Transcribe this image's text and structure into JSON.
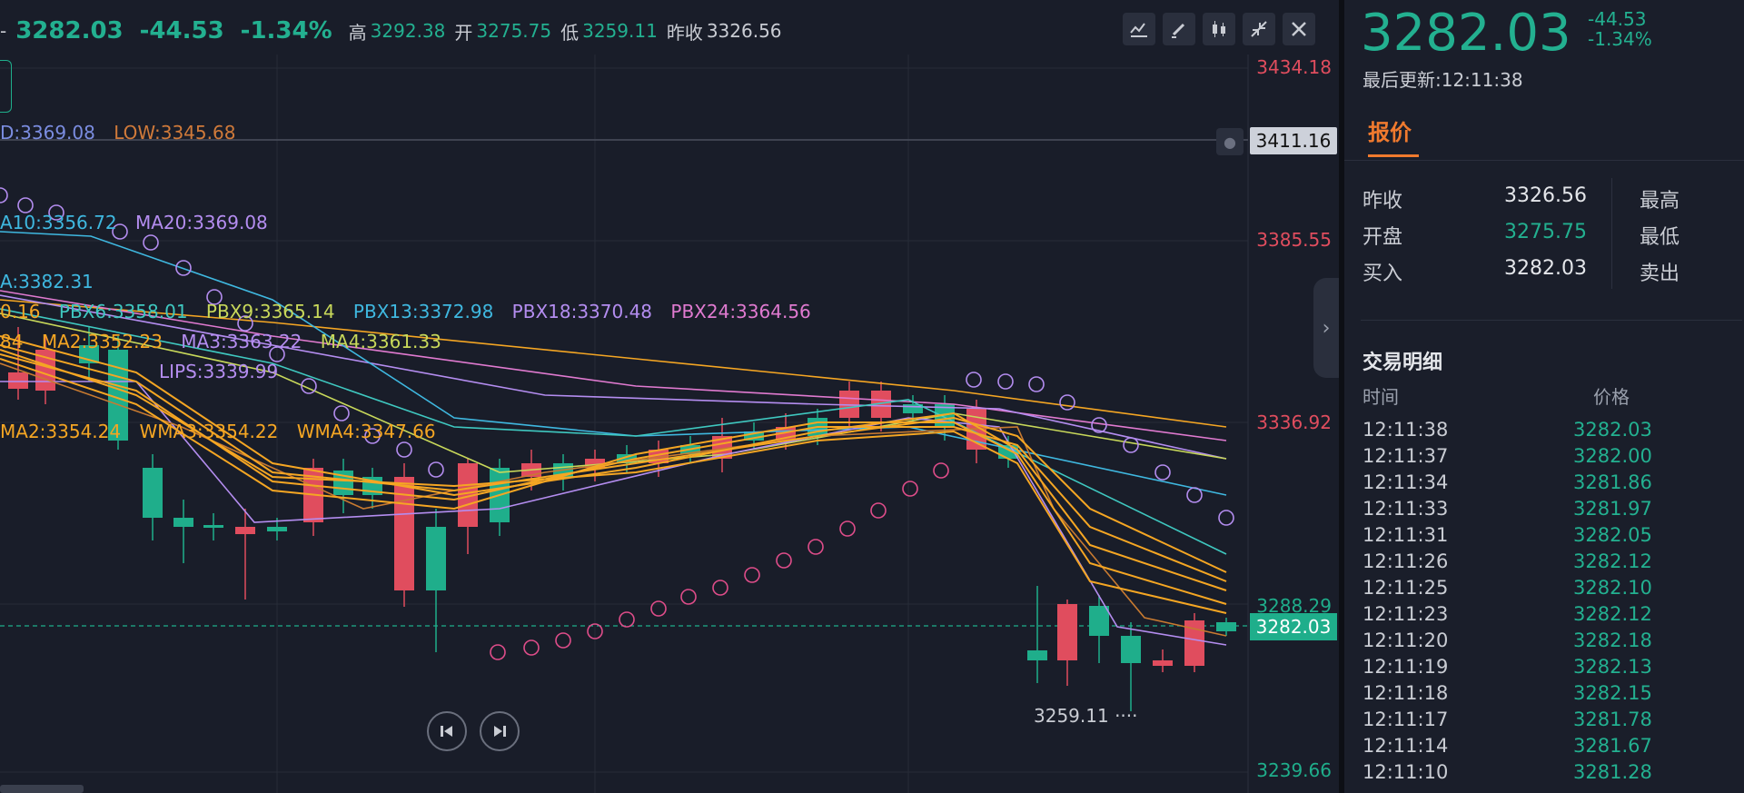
{
  "header": {
    "last": "3282.03",
    "change": "-44.53",
    "change_pct": "-1.34%",
    "high_label": "高",
    "high": "3292.38",
    "open_label": "开",
    "open": "3275.75",
    "low_label": "低",
    "low": "3259.11",
    "prev_label": "昨收",
    "prev": "3326.56"
  },
  "tools": [
    "indicator-icon",
    "draw-icon",
    "candle-icon",
    "collapse-icon",
    "close-icon"
  ],
  "legends": {
    "hl": [
      "D:3369.08",
      "LOW:3345.68"
    ],
    "ma": [
      "A10:3356.72",
      "MA20:3369.08"
    ],
    "ema": [
      "A:3382.31"
    ],
    "pbx": [
      "0.16",
      "PBX6:3358.01",
      "PBX9:3365.14",
      "PBX13:3372.98",
      "PBX18:3370.48",
      "PBX24:3364.56"
    ],
    "ma2": [
      "84",
      "MA2:3352.23",
      "MA3:3363.22",
      "MA4:3361.33"
    ],
    "lips": [
      "LIPS:3339.99"
    ],
    "wma": [
      "MA2:3354.24",
      "WMA3:3354.22",
      "WMA4:3347.66"
    ]
  },
  "axis": {
    "p1": "3434.18",
    "p2": "3411.16",
    "p3": "3385.55",
    "p4": "3336.92",
    "p5": "3288.29",
    "p6": "3282.03",
    "p7": "3239.66"
  },
  "min_label": "3259.11",
  "panel": {
    "price": "3282.03",
    "change": "-44.53",
    "change_pct": "-1.34%",
    "updated": "最后更新:12:11:38",
    "tab": "报价",
    "quote": [
      {
        "label": "昨收",
        "value": "3326.56",
        "right": "最高"
      },
      {
        "label": "开盘",
        "value": "3275.75",
        "right": "最低"
      },
      {
        "label": "买入",
        "value": "3282.03",
        "right": "卖出"
      }
    ],
    "section": "交易明细",
    "col_time": "时间",
    "col_price": "价格",
    "trades": [
      {
        "t": "12:11:38",
        "p": "3282.03"
      },
      {
        "t": "12:11:37",
        "p": "3282.00"
      },
      {
        "t": "12:11:34",
        "p": "3281.86"
      },
      {
        "t": "12:11:33",
        "p": "3281.97"
      },
      {
        "t": "12:11:31",
        "p": "3282.05"
      },
      {
        "t": "12:11:26",
        "p": "3282.12"
      },
      {
        "t": "12:11:25",
        "p": "3282.10"
      },
      {
        "t": "12:11:23",
        "p": "3282.12"
      },
      {
        "t": "12:11:20",
        "p": "3282.18"
      },
      {
        "t": "12:11:19",
        "p": "3282.13"
      },
      {
        "t": "12:11:18",
        "p": "3282.15"
      },
      {
        "t": "12:11:17",
        "p": "3281.78"
      },
      {
        "t": "12:11:14",
        "p": "3281.67"
      },
      {
        "t": "12:11:10",
        "p": "3281.28"
      }
    ]
  },
  "colors": {
    "up": "#e04d5e",
    "down": "#1fae8b",
    "accent": "#f07a2e"
  }
}
